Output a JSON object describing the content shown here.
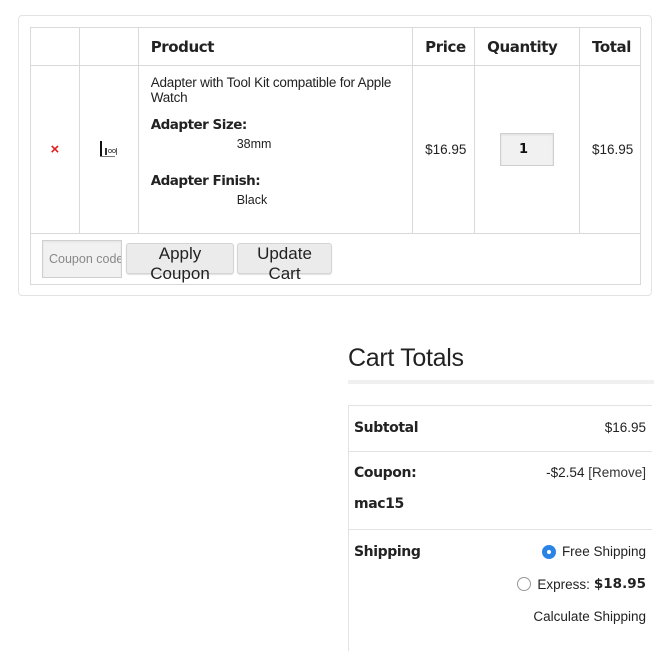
{
  "cart": {
    "headers": {
      "remove": "",
      "thumbnail": "",
      "product": "Product",
      "price": "Price",
      "quantity": "Quantity",
      "total": "Total"
    },
    "items": [
      {
        "remove_icon": "×",
        "thumbnail_icon": "tool-kit-thumbnail",
        "name": "Adapter with Tool Kit compatible for Apple Watch",
        "variants": [
          {
            "label": "Adapter Size:",
            "value": "38mm"
          },
          {
            "label": "Adapter Finish:",
            "value": "Black"
          }
        ],
        "price": "$16.95",
        "quantity": "1",
        "total": "$16.95"
      }
    ],
    "coupon_placeholder": "Coupon code",
    "apply_coupon_label": "Apply Coupon",
    "update_cart_label": "Update Cart"
  },
  "totals": {
    "title": "Cart Totals",
    "subtotal_label": "Subtotal",
    "subtotal_value": "$16.95",
    "coupon_label": "Coupon:",
    "coupon_code": "mac15",
    "coupon_discount": "-$2.54",
    "coupon_remove": "[Remove]",
    "shipping_label": "Shipping",
    "shipping_options": [
      {
        "label": "Free Shipping",
        "price": "",
        "checked": true
      },
      {
        "label": "Express:",
        "price": "$18.95",
        "checked": false
      }
    ],
    "calculate_shipping": "Calculate Shipping"
  },
  "colors": {
    "remove": "#e02020",
    "radio_checked": "#2b84e5",
    "border": "#d9d9d9"
  }
}
